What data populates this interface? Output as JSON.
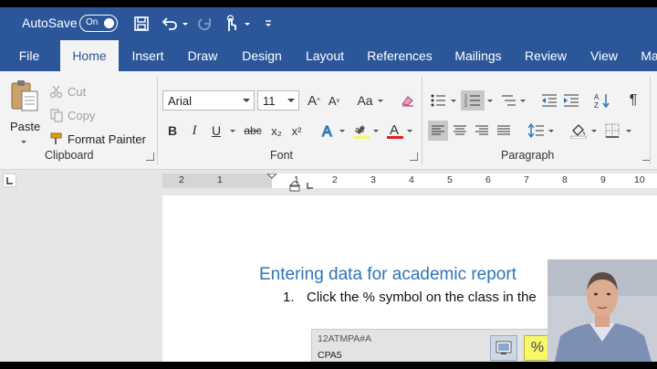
{
  "titlebar": {
    "autosave_label": "AutoSave",
    "autosave_state": "On",
    "icons": [
      "save-icon",
      "undo-icon",
      "redo-icon",
      "touch-mode-icon",
      "customize-qat-icon"
    ]
  },
  "tabs": [
    {
      "label": "File"
    },
    {
      "label": "Home"
    },
    {
      "label": "Insert"
    },
    {
      "label": "Draw"
    },
    {
      "label": "Design"
    },
    {
      "label": "Layout"
    },
    {
      "label": "References"
    },
    {
      "label": "Mailings"
    },
    {
      "label": "Review"
    },
    {
      "label": "View"
    },
    {
      "label": "Ma"
    }
  ],
  "active_tab": "Home",
  "clipboard": {
    "paste": "Paste",
    "cut": "Cut",
    "copy": "Copy",
    "format_painter": "Format Painter",
    "group_label": "Clipboard"
  },
  "font": {
    "family": "Arial",
    "size": "11",
    "case_label": "Aa",
    "bold": "B",
    "italic": "I",
    "underline": "U",
    "strike": "abc",
    "subscript": "x₂",
    "superscript": "x²",
    "group_label": "Font"
  },
  "paragraph": {
    "group_label": "Paragraph"
  },
  "ruler": {
    "numbers": [
      "2",
      "1",
      "1",
      "2",
      "3",
      "4",
      "5",
      "6",
      "7",
      "8",
      "9",
      "10"
    ]
  },
  "document": {
    "heading": "Entering data for academic report",
    "list_number": "1.",
    "list_text": "Click the % symbol on the class in the"
  },
  "popup": {
    "code": "12ATMPA#A",
    "subtitle": "CPA5",
    "percent_button": "%"
  },
  "colors": {
    "brand": "#2b579a",
    "ribbon_bg": "#f3f3f3",
    "heading": "#2e74b5",
    "highlight": "#f7f76a",
    "font_color_red": "#e02020"
  }
}
